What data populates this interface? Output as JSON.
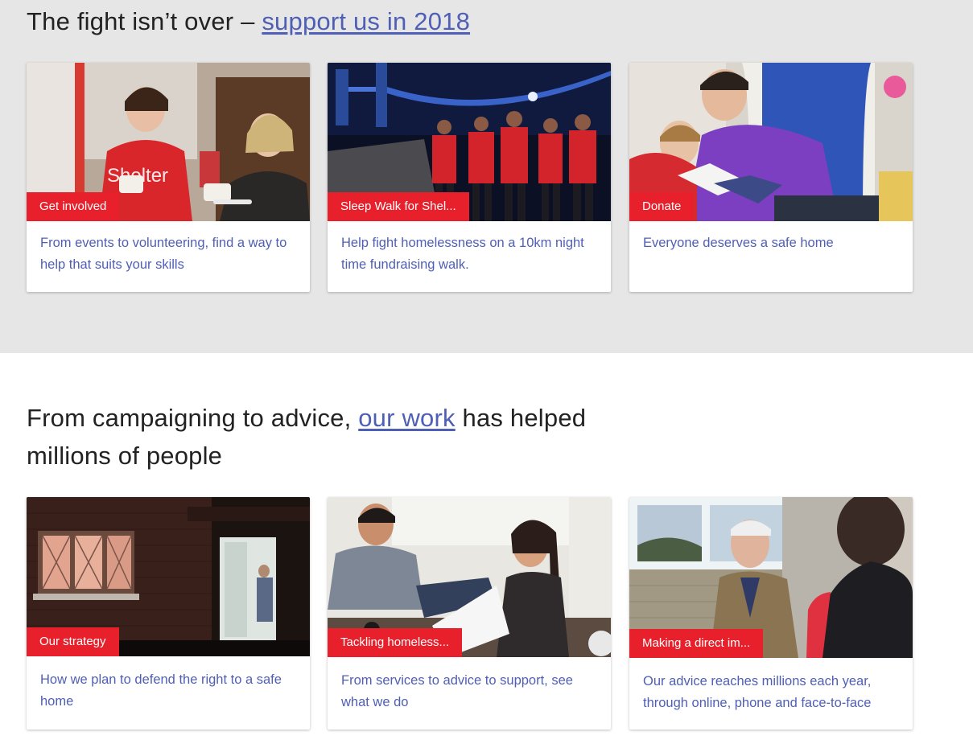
{
  "section1": {
    "heading_text": "The fight isn’t over – ",
    "heading_link": "support us in 2018",
    "cards": [
      {
        "tag": "Get involved",
        "text": "From events to volunteering, find a way to help that suits your skills"
      },
      {
        "tag": "Sleep Walk for Shel...",
        "text": "Help fight homelessness on a 10km night time fundraising walk."
      },
      {
        "tag": "Donate",
        "text": "Everyone deserves a safe home"
      }
    ]
  },
  "section2": {
    "heading_pre": "From campaigning to advice, ",
    "heading_link": "our work",
    "heading_post": " has helped millions of people",
    "cards": [
      {
        "tag": "Our strategy",
        "text": "How we plan to defend the right to a safe home"
      },
      {
        "tag": "Tackling homeless...",
        "text": "From services to advice to support, see what we do"
      },
      {
        "tag": "Making a direct im...",
        "text": "Our advice reaches millions each year, through online, phone and face-to-face"
      }
    ]
  },
  "colors": {
    "accent_red": "#e8202b",
    "link_blue": "#4f5fb5",
    "band_grey": "#e6e6e6"
  }
}
